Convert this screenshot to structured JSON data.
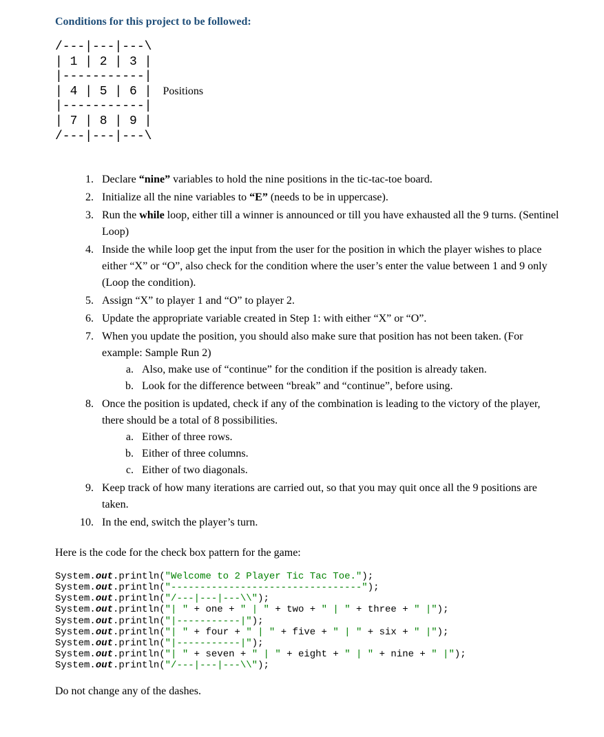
{
  "heading": "Conditions for this project to be followed:",
  "board": {
    "line1": "/---|---|---\\",
    "line2": "| 1 | 2 | 3 |",
    "line3": "|-----------|",
    "line4a": "| 4 | 5 | 6 |",
    "line4b": "  Positions",
    "line5": "|-----------|",
    "line6": "| 7 | 8 | 9 |",
    "line7": "/---|---|---\\"
  },
  "list": {
    "item1a": "Declare ",
    "item1b": "“nine”",
    "item1c": " variables to hold the nine positions in the tic-tac-toe board.",
    "item2a": "Initialize all the nine variables to ",
    "item2b": "“E”",
    "item2c": " (needs to be in uppercase).",
    "item3a": "Run the ",
    "item3b": "while",
    "item3c": " loop, either till a winner is announced or till you have exhausted all the 9 turns. (Sentinel Loop)",
    "item4": "Inside the while loop get the input from the user for the position in which the player wishes to place either “X” or “O”, also check for the condition where the user’s enter the value between 1 and 9 only (Loop the condition).",
    "item5": "Assign “X” to player 1 and “O” to player 2.",
    "item6": "Update the appropriate variable created in Step 1: with either “X” or “O”.",
    "item7": "When you update the position, you should also make sure that position has not been taken. (For example: Sample Run 2)",
    "item7a": "Also, make use of “continue” for the condition if the position is already taken.",
    "item7b": "Look for the difference between “break” and “continue”, before using.",
    "item8": "Once the position is updated, check if any of the combination is leading to the victory of the player, there should be a total of 8 possibilities.",
    "item8a": "Either of three rows.",
    "item8b": "Either of three columns.",
    "item8c": "Either of two diagonals.",
    "item9": "Keep track of how many iterations are carried out, so that you may quit once all the 9 positions are taken.",
    "item10": "In the end, switch the player’s turn."
  },
  "intro_code": "Here is the code for the check box pattern for the game:",
  "code": {
    "sys": "System.",
    "out": "out",
    "println": ".println(",
    "close": ");",
    "s1": "\"Welcome to 2 Player Tic Tac Toe.\"",
    "s2": "\"---------------------------------\"",
    "s3": "\"/---|---|---\\\\\"",
    "s4a": "\"| \"",
    "plus": " + ",
    "one": "one",
    "s4b": "\" | \"",
    "two": "two",
    "three": "three",
    "s4c": "\" |\"",
    "s5": "\"|-----------|\"",
    "four": "four",
    "five": "five",
    "six": "six",
    "seven": "seven",
    "eight": "eight",
    "nine": "nine",
    "s7": "\"/---|---|---\\\\\""
  },
  "footer": "Do not change any of the dashes."
}
